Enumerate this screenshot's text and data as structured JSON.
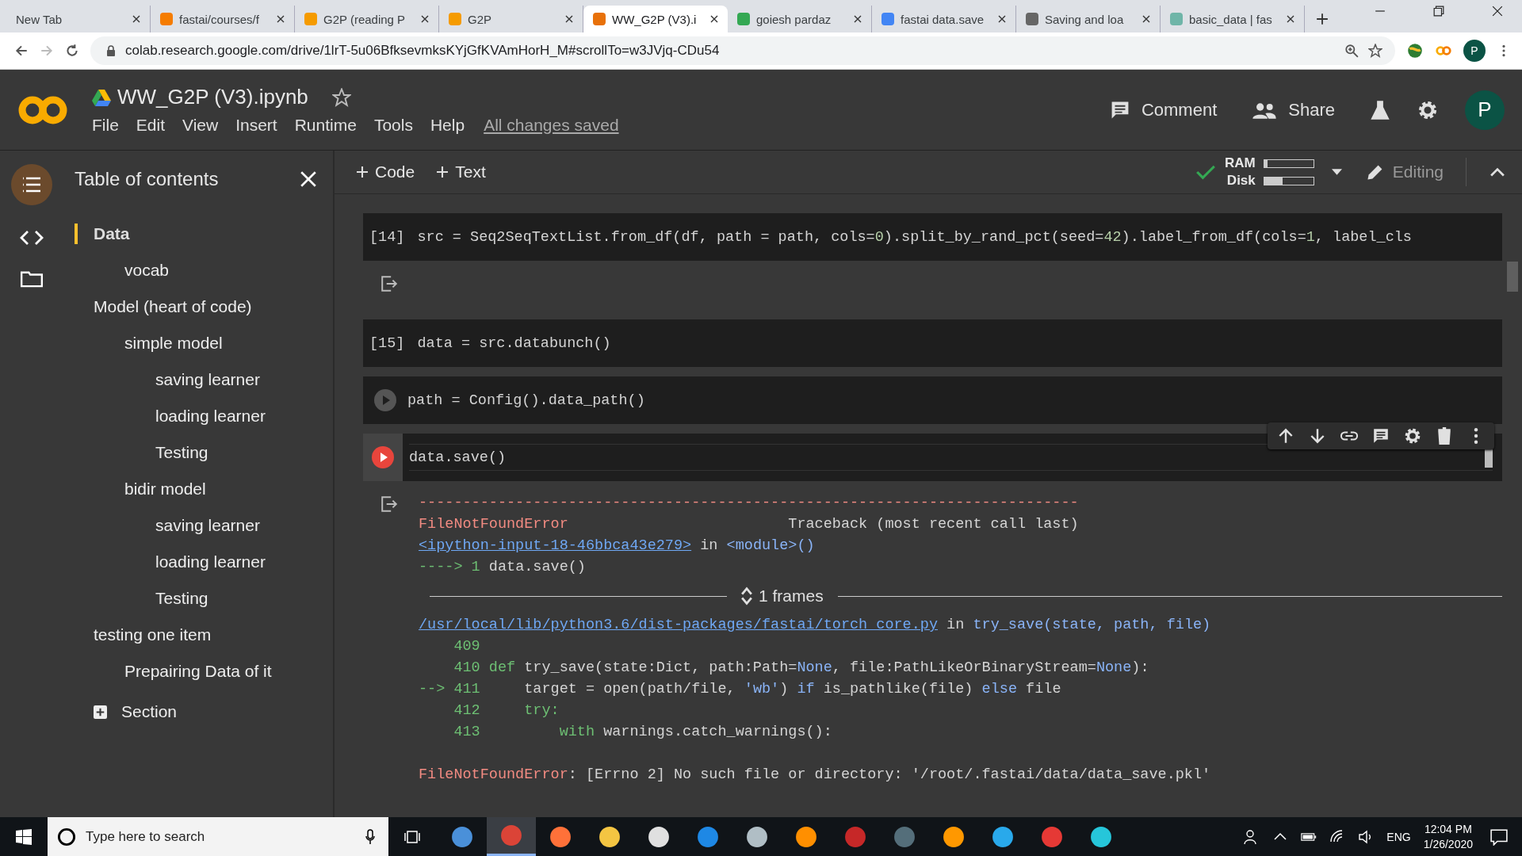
{
  "browser": {
    "tabs": [
      {
        "title": "New Tab",
        "selected": false
      },
      {
        "title": "fastai/courses/f",
        "selected": false,
        "color": "#f57c00"
      },
      {
        "title": "G2P (reading P",
        "selected": false,
        "color": "#f59b00"
      },
      {
        "title": "G2P",
        "selected": false,
        "color": "#f59b00"
      },
      {
        "title": "WW_G2P (V3).i",
        "selected": true,
        "color": "#e8710a"
      },
      {
        "title": "goiesh pardaz",
        "selected": false,
        "color": "#34a853"
      },
      {
        "title": "fastai data.save",
        "selected": false,
        "color": "#4285f4"
      },
      {
        "title": "Saving and loa",
        "selected": false,
        "color": "#666666"
      },
      {
        "title": "basic_data | fas",
        "selected": false,
        "color": "#6fb5a8"
      }
    ],
    "url": "colab.research.google.com/drive/1lrT-5u06BfksevmksKYjGfKVAmHorH_M#scrollTo=w3JVjq-CDu54",
    "profile_initial": "P"
  },
  "notebook": {
    "title": "WW_G2P (V3).ipynb",
    "menus": [
      "File",
      "Edit",
      "View",
      "Insert",
      "Runtime",
      "Tools",
      "Help"
    ],
    "save_status": "All changes saved",
    "actions": [
      "Comment",
      "Share"
    ],
    "avatar": "P"
  },
  "toolbar": {
    "insert_buttons": [
      "Code",
      "Text"
    ],
    "resources": [
      {
        "label": "RAM",
        "level": 0.06
      },
      {
        "label": "Disk",
        "level": 0.38
      }
    ],
    "mode": "Editing"
  },
  "sidebar": {
    "title": "Table of contents",
    "toc": [
      {
        "label": "Data",
        "selected": true,
        "children": [
          {
            "label": "vocab",
            "selected": false
          }
        ]
      },
      {
        "label": "Model (heart of code)",
        "selected": false,
        "children": [
          {
            "label": "simple model",
            "selected": false,
            "children": [
              {
                "label": "saving learner",
                "selected": false
              },
              {
                "label": "loading learner",
                "selected": false
              },
              {
                "label": "Testing",
                "selected": false
              }
            ]
          },
          {
            "label": "bidir model",
            "selected": false,
            "children": [
              {
                "label": "saving learner",
                "selected": false
              },
              {
                "label": "loading learner",
                "selected": false
              },
              {
                "label": "Testing",
                "selected": false
              }
            ]
          }
        ]
      },
      {
        "label": "testing one item",
        "selected": false,
        "children": [
          {
            "label": "Prepairing Data of it",
            "selected": false
          }
        ]
      }
    ],
    "add_section": "Section"
  },
  "cells": [
    {
      "kind": "executed",
      "prompt": "[14]",
      "code": [
        {
          "kind": "plain",
          "text": "src = Seq2SeqTextList.from_df(df, path = path, cols="
        },
        {
          "kind": "number",
          "text": "0"
        },
        {
          "kind": "plain",
          "text": ").split_by_rand_pct(seed="
        },
        {
          "kind": "number",
          "text": "42"
        },
        {
          "kind": "plain",
          "text": ").label_from_df(cols="
        },
        {
          "kind": "number",
          "text": "1"
        },
        {
          "kind": "plain",
          "text": ", label_cls"
        }
      ],
      "output": {
        "kind": "empty"
      }
    },
    {
      "kind": "executed",
      "prompt": "[15]",
      "code": [
        {
          "kind": "plain",
          "text": "data = src.databunch()"
        }
      ]
    },
    {
      "kind": "idle",
      "code": [
        {
          "kind": "plain",
          "text": "path = Config().data_path()"
        }
      ]
    },
    {
      "kind": "focused",
      "code": [
        {
          "kind": "plain",
          "text": "data.save()"
        }
      ],
      "output": {
        "kind": "traceback",
        "lines": [
          {
            "kind": "code",
            "tokens": [
              {
                "kind": "error",
                "text": "---------------------------------------------------------------------------"
              }
            ]
          },
          {
            "kind": "code",
            "tokens": [
              {
                "kind": "error",
                "text": "FileNotFoundError"
              },
              {
                "kind": "plain",
                "text": "                         Traceback (most recent call last)"
              }
            ]
          },
          {
            "kind": "code",
            "tokens": [
              {
                "kind": "link",
                "text": "<ipython-input-18-46bbca43e279>"
              },
              {
                "kind": "plain",
                "text": " in "
              },
              {
                "kind": "blue",
                "text": "<module>()"
              }
            ]
          },
          {
            "kind": "code",
            "tokens": [
              {
                "kind": "green",
                "text": "----> 1 "
              },
              {
                "kind": "plain",
                "text": "data.save()"
              }
            ]
          },
          {
            "kind": "frames",
            "text": "1 frames"
          },
          {
            "kind": "code",
            "tokens": [
              {
                "kind": "link",
                "text": "/usr/local/lib/python3.6/dist-packages/fastai/torch_core.py"
              },
              {
                "kind": "plain",
                "text": " in "
              },
              {
                "kind": "blue",
                "text": "try_save(state, path, file)"
              }
            ]
          },
          {
            "kind": "code",
            "tokens": [
              {
                "kind": "green",
                "text": "    409"
              }
            ]
          },
          {
            "kind": "code",
            "tokens": [
              {
                "kind": "green",
                "text": "    410 def"
              },
              {
                "kind": "plain",
                "text": " try_save(state:Dict, path:Path="
              },
              {
                "kind": "blue",
                "text": "None"
              },
              {
                "kind": "plain",
                "text": ", file:PathLikeOrBinaryStream="
              },
              {
                "kind": "blue",
                "text": "None"
              },
              {
                "kind": "plain",
                "text": "):"
              }
            ]
          },
          {
            "kind": "code",
            "tokens": [
              {
                "kind": "green",
                "text": "--> 411"
              },
              {
                "kind": "plain",
                "text": "     target = open(path/file, "
              },
              {
                "kind": "blue",
                "text": "'wb'"
              },
              {
                "kind": "plain",
                "text": ") "
              },
              {
                "kind": "blue",
                "text": "if"
              },
              {
                "kind": "plain",
                "text": " is_pathlike(file) "
              },
              {
                "kind": "blue",
                "text": "else"
              },
              {
                "kind": "plain",
                "text": " file"
              }
            ]
          },
          {
            "kind": "code",
            "tokens": [
              {
                "kind": "green",
                "text": "    412     try:"
              }
            ]
          },
          {
            "kind": "code",
            "tokens": [
              {
                "kind": "green",
                "text": "    413         with"
              },
              {
                "kind": "plain",
                "text": " warnings.catch_warnings():"
              }
            ]
          },
          {
            "kind": "blank"
          },
          {
            "kind": "code",
            "tokens": [
              {
                "kind": "error",
                "text": "FileNotFoundError"
              },
              {
                "kind": "plain",
                "text": ": [Errno 2] No such file or directory: '/root/.fastai/data/data_save.pkl'"
              }
            ]
          }
        ]
      }
    }
  ],
  "taskbar": {
    "search_placeholder": "Type here to search",
    "apps": [
      {
        "color": "#4a90d9",
        "selected": false
      },
      {
        "color": "#db4437",
        "selected": true
      },
      {
        "color": "#ff7139",
        "selected": false
      },
      {
        "color": "#f4c542",
        "selected": false
      },
      {
        "color": "#e0e0e0",
        "selected": false
      },
      {
        "color": "#1e88e5",
        "selected": false
      },
      {
        "color": "#b0bec5",
        "selected": false
      },
      {
        "color": "#ff8f00",
        "selected": false
      },
      {
        "color": "#c62828",
        "selected": false
      },
      {
        "color": "#546e7a",
        "selected": false
      },
      {
        "color": "#ff9800",
        "selected": false
      },
      {
        "color": "#29a9eb",
        "selected": false
      },
      {
        "color": "#e53935",
        "selected": false
      },
      {
        "color": "#26c6da",
        "selected": false
      }
    ],
    "language": "ENG",
    "time": "12:04 PM",
    "date": "1/26/2020"
  }
}
